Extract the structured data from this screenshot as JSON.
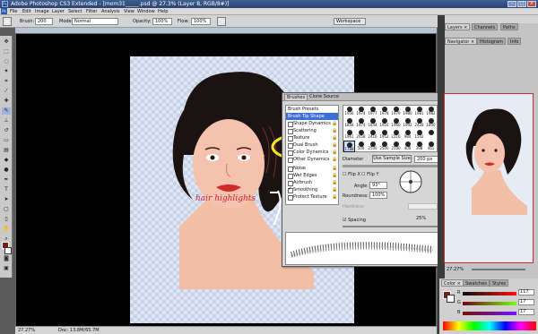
{
  "window": {
    "title": "Adobe Photoshop CS3 Extended - [mom31_____.psd @ 27.3% (Layer 8, RGB/8#)]"
  },
  "menu": [
    "File",
    "Edit",
    "Image",
    "Layer",
    "Select",
    "Filter",
    "Analysis",
    "View",
    "Window",
    "Help"
  ],
  "options": {
    "brush_label": "Brush:",
    "brush_size": "200",
    "mode_label": "Mode:",
    "mode_value": "Normal",
    "opacity_label": "Opacity:",
    "opacity_value": "100%",
    "flow_label": "Flow:",
    "flow_value": "100%",
    "workspace_label": "Workspace"
  },
  "canvas": {
    "annotation": "hair highlights"
  },
  "status": {
    "zoom": "27.27%",
    "doc": "Doc: 13.8M/65.7M"
  },
  "brushes": {
    "tabs": [
      "Brushes",
      "Clone Source"
    ],
    "items": [
      {
        "label": "Brush Presets",
        "type": "header"
      },
      {
        "label": "Brush Tip Shape",
        "type": "selected"
      },
      {
        "label": "Shape Dynamics",
        "type": "cb",
        "checked": false
      },
      {
        "label": "Scattering",
        "type": "cb",
        "checked": false
      },
      {
        "label": "Texture",
        "type": "cb",
        "checked": false
      },
      {
        "label": "Dual Brush",
        "type": "cb",
        "checked": false
      },
      {
        "label": "Color Dynamics",
        "type": "cb",
        "checked": false
      },
      {
        "label": "Other Dynamics",
        "type": "cb",
        "checked": false
      },
      {
        "label": "Noise",
        "type": "cb",
        "checked": false
      },
      {
        "label": "Wet Edges",
        "type": "cb",
        "checked": false
      },
      {
        "label": "Airbrush",
        "type": "cb",
        "checked": false
      },
      {
        "label": "Smoothing",
        "type": "cb",
        "checked": true
      },
      {
        "label": "Protect Texture",
        "type": "cb",
        "checked": false
      }
    ],
    "tips_row1": [
      "1956",
      "1974",
      "1977",
      "1978",
      "1979",
      "1980",
      "1981",
      "1982"
    ],
    "tips_row2": [
      "1844",
      "1974",
      "1844",
      "1916",
      "1960",
      "1992",
      "2428",
      "1800"
    ],
    "tips_row3": [
      "1961",
      "2058",
      "2416",
      "1952",
      "2216",
      "984",
      "1542",
      ""
    ],
    "tips_row4": [
      "1788",
      "500",
      "2500",
      "2500",
      "2500",
      "400",
      "398",
      "461"
    ],
    "diameter_label": "Diameter",
    "sample_btn": "Use Sample Size",
    "diameter_value": "200 px",
    "flipx": "Flip X",
    "flipy": "Flip Y",
    "angle_label": "Angle:",
    "angle_value": "93°",
    "roundness_label": "Roundness:",
    "roundness_value": "100%",
    "hardness_label": "Hardness",
    "spacing_label": "Spacing",
    "spacing_value": "25%"
  },
  "right": {
    "top_tabs": [
      "Layers ×",
      "Channels",
      "Paths"
    ],
    "nav_tabs": [
      "Navigator ×",
      "Histogram",
      "Info"
    ],
    "nav_zoom": "27.27%",
    "color_tabs": [
      "Color ×",
      "Swatches",
      "Styles"
    ],
    "r_label": "R",
    "g_label": "G",
    "b_label": "B",
    "r": "117",
    "g": "17",
    "b": "17"
  },
  "colors": {
    "accent": "#3b6fd6",
    "fg": "#7a1d1d",
    "highlight": "#f5e62a"
  }
}
